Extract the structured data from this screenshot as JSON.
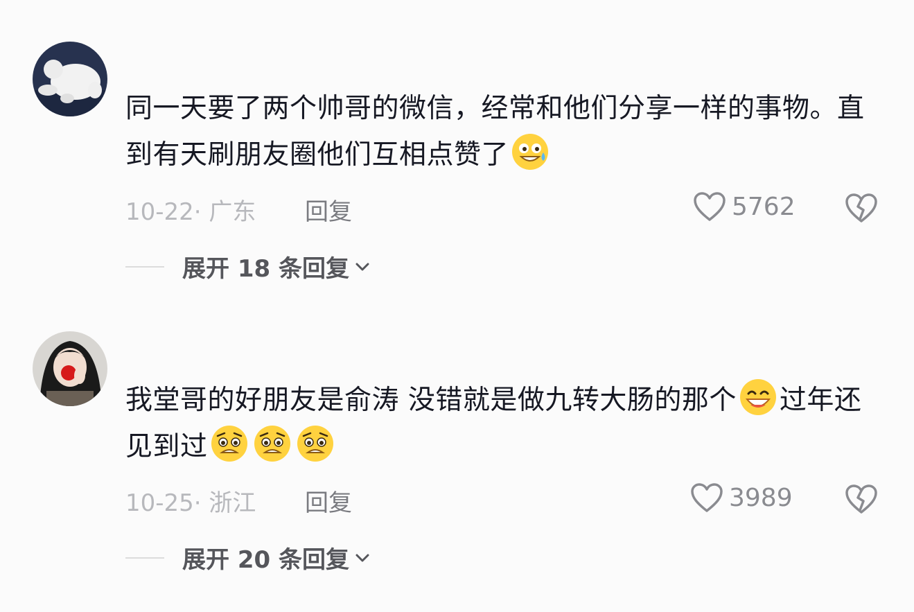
{
  "comments": [
    {
      "text_parts": [
        "同一天要了两个帅哥的微信，经常和他们分享一样的事物。直到有天刷朋友圈他们互相点赞了"
      ],
      "emoji_trailing": [
        "sweat-grin-emoji"
      ],
      "date_location": "10-22· 广东",
      "reply_label": "回复",
      "likes": "5762",
      "expand_label": "展开 18 条回复"
    },
    {
      "text_parts": [
        "我堂哥的好朋友是俞涛 没错就是做九转大肠的那个",
        "过年还见到过"
      ],
      "emoji_mid": "grin-emoji",
      "emoji_trailing": [
        "pleading-emoji",
        "pleading-emoji",
        "pleading-emoji"
      ],
      "date_location": "10-25· 浙江",
      "reply_label": "回复",
      "likes": "3989",
      "expand_label": "展开 20 条回复"
    }
  ],
  "icons": {
    "like": "heart-outline-icon",
    "dislike": "broken-heart-icon",
    "expand": "chevron-down-icon"
  }
}
